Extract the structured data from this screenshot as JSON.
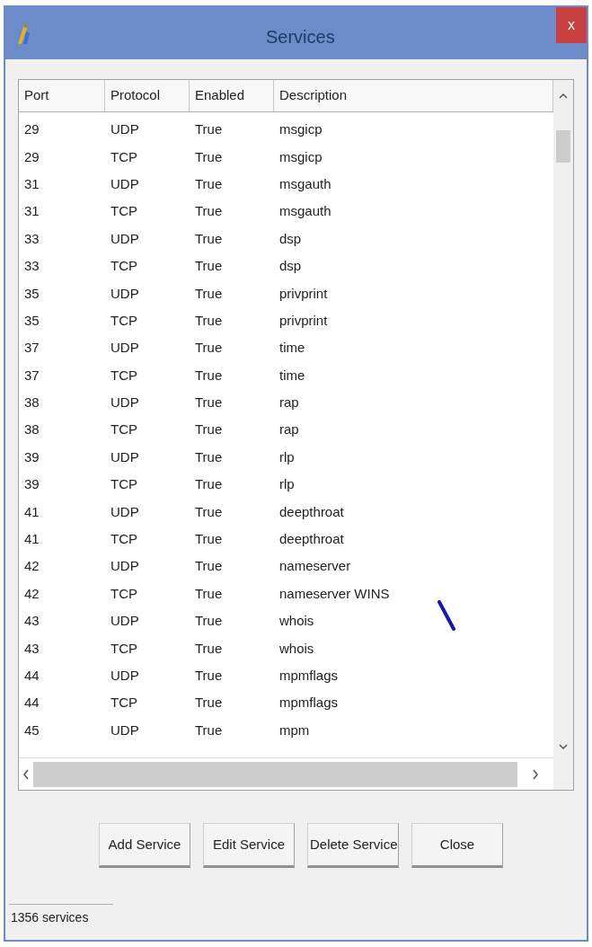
{
  "window": {
    "title": "Services",
    "close": "x"
  },
  "table": {
    "columns": [
      "Port",
      "Protocol",
      "Enabled",
      "Description"
    ],
    "rows": [
      [
        "29",
        "UDP",
        "True",
        "msgicp"
      ],
      [
        "29",
        "TCP",
        "True",
        "msgicp"
      ],
      [
        "31",
        "UDP",
        "True",
        "msgauth"
      ],
      [
        "31",
        "TCP",
        "True",
        "msgauth"
      ],
      [
        "33",
        "UDP",
        "True",
        "dsp"
      ],
      [
        "33",
        "TCP",
        "True",
        "dsp"
      ],
      [
        "35",
        "UDP",
        "True",
        "privprint"
      ],
      [
        "35",
        "TCP",
        "True",
        "privprint"
      ],
      [
        "37",
        "UDP",
        "True",
        "time"
      ],
      [
        "37",
        "TCP",
        "True",
        "time"
      ],
      [
        "38",
        "UDP",
        "True",
        "rap"
      ],
      [
        "38",
        "TCP",
        "True",
        "rap"
      ],
      [
        "39",
        "UDP",
        "True",
        "rlp"
      ],
      [
        "39",
        "TCP",
        "True",
        "rlp"
      ],
      [
        "41",
        "UDP",
        "True",
        "deepthroat"
      ],
      [
        "41",
        "TCP",
        "True",
        "deepthroat"
      ],
      [
        "42",
        "UDP",
        "True",
        "nameserver"
      ],
      [
        "42",
        "TCP",
        "True",
        "nameserver WINS"
      ],
      [
        "43",
        "UDP",
        "True",
        "whois"
      ],
      [
        "43",
        "TCP",
        "True",
        "whois"
      ],
      [
        "44",
        "UDP",
        "True",
        "mpmflags"
      ],
      [
        "44",
        "TCP",
        "True",
        "mpmflags"
      ],
      [
        "45",
        "UDP",
        "True",
        "mpm"
      ]
    ]
  },
  "buttons": [
    "Add Service",
    "Edit Service",
    "Delete Service",
    "Close"
  ],
  "status_bar": "1356 services"
}
